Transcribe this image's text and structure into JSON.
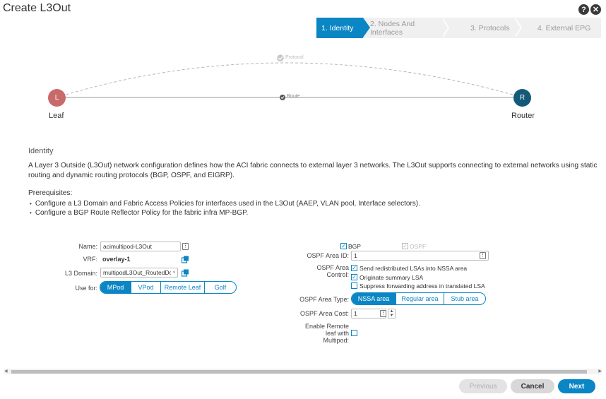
{
  "window": {
    "title": "Create L3Out"
  },
  "header": {
    "help_icon": "?",
    "close_icon": "✕"
  },
  "wizard": {
    "steps": [
      {
        "label": "1. Identity"
      },
      {
        "label": "2. Nodes And Interfaces"
      },
      {
        "label": "3. Protocols"
      },
      {
        "label": "4. External EPG"
      }
    ]
  },
  "diagram": {
    "leaf": {
      "letter": "L",
      "label": "Leaf"
    },
    "router": {
      "letter": "R",
      "label": "Router"
    },
    "protocol_label": "Protocol",
    "route_label": "Route"
  },
  "identity": {
    "section_title": "Identity",
    "description": "A Layer 3 Outside (L3Out) network configuration defines how the ACI fabric connects to external layer 3 networks. The L3Out supports connecting to external networks using static routing and dynamic routing protocols (BGP, OSPF, and EIGRP).",
    "prereq_title": "Prerequisites:",
    "prereqs": [
      "Configure a L3 Domain and Fabric Access Policies for interfaces used in the L3Out (AAEP, VLAN pool, Interface selectors).",
      "Configure a BGP Route Reflector Policy for the fabric infra MP-BGP."
    ]
  },
  "form_left": {
    "name_label": "Name:",
    "name_value": "acimultipod-L3Out",
    "vrf_label": "VRF:",
    "vrf_value": "overlay-1",
    "domain_label": "L3 Domain:",
    "domain_value": "multipodL3Out_RoutedDo",
    "usefor_label": "Use for:",
    "usefor_options": [
      "MPod",
      "VPod",
      "Remote Leaf",
      "Golf"
    ],
    "usefor_selected": "MPod"
  },
  "form_right": {
    "bgp_label": "BGP",
    "ospf_label": "OSPF",
    "area_id_label": "OSPF Area ID:",
    "area_id_value": "1",
    "area_control_label": "OSPF Area Control:",
    "area_control_options": [
      {
        "label": "Send redistributed LSAs into NSSA area",
        "checked": true
      },
      {
        "label": "Originate summary LSA",
        "checked": true
      },
      {
        "label": "Suppress forwarding address in translated LSA",
        "checked": false
      }
    ],
    "area_type_label": "OSPF Area Type:",
    "area_type_options": [
      "NSSA area",
      "Regular area",
      "Stub area"
    ],
    "area_type_selected": "NSSA area",
    "area_cost_label": "OSPF Area Cost:",
    "area_cost_value": "1",
    "remote_leaf_label": "Enable Remote leaf with Multipod:"
  },
  "footer": {
    "previous_label": "Previous",
    "cancel_label": "Cancel",
    "next_label": "Next"
  },
  "colors": {
    "accent": "#0a86c4",
    "leaf": "#c86a6a",
    "router": "#145a78"
  }
}
